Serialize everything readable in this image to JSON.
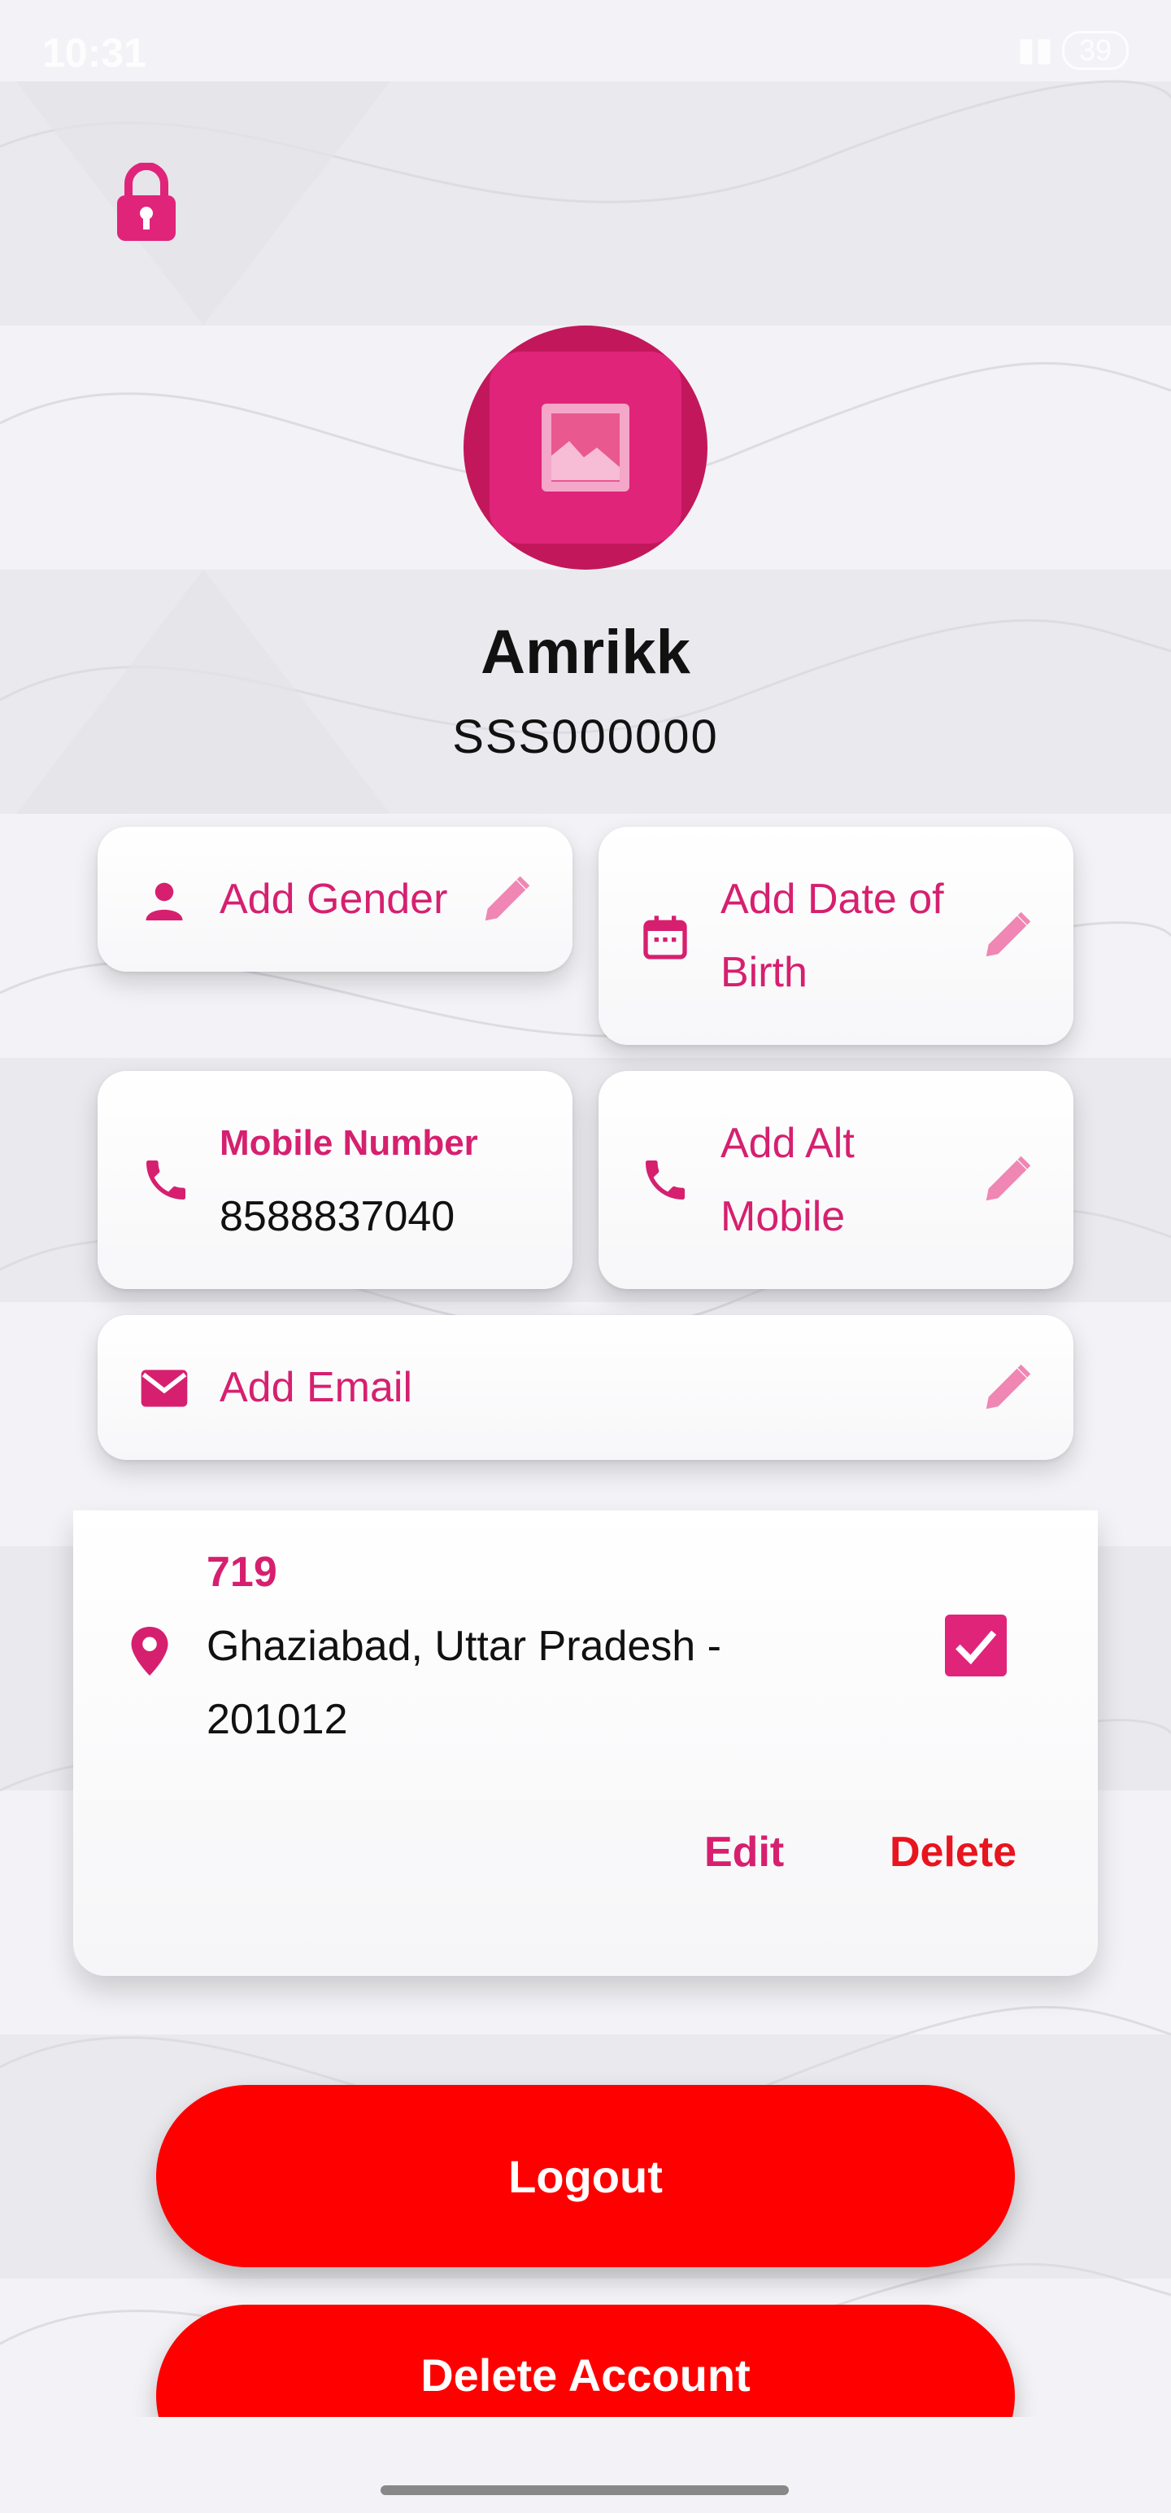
{
  "status_bar": {
    "time": "10:31",
    "battery": "39"
  },
  "profile": {
    "name": "Amrikk",
    "code": "SSS000000"
  },
  "fields": {
    "gender": "Add Gender",
    "dob": "Add Date of Birth",
    "mobile_label": "Mobile Number",
    "mobile_value": "8588837040",
    "alt_mobile": "Add Alt Mobile",
    "email": "Add Email"
  },
  "address": {
    "title": "719",
    "line": "Ghaziabad, Uttar Pradesh - 201012",
    "edit_label": "Edit",
    "delete_label": "Delete",
    "selected": true
  },
  "actions": {
    "logout": "Logout",
    "delete_account": "Delete Account"
  },
  "colors": {
    "accent": "#d6206f",
    "danger": "#ff0000",
    "avatar_ring": "#c2185b"
  }
}
